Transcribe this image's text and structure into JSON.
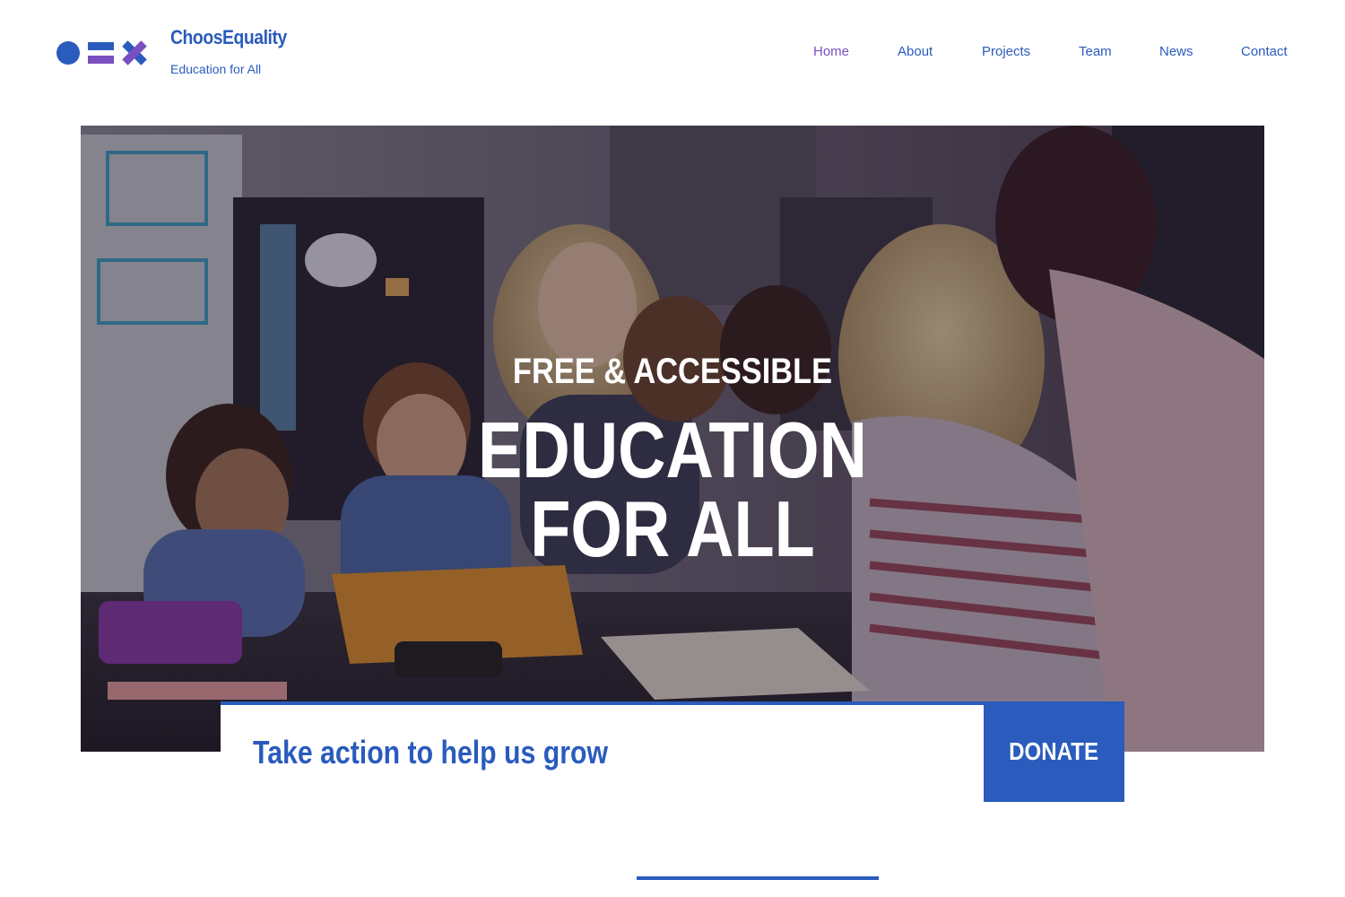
{
  "header": {
    "brand_name": "ChoosEquality",
    "tagline": "Education for All",
    "logo_icon": "circle-equals-cross-logo"
  },
  "nav": {
    "items": [
      {
        "label": "Home",
        "active": true
      },
      {
        "label": "About",
        "active": false
      },
      {
        "label": "Projects",
        "active": false
      },
      {
        "label": "Team",
        "active": false
      },
      {
        "label": "News",
        "active": false
      },
      {
        "label": "Contact",
        "active": false
      }
    ]
  },
  "hero": {
    "kicker": "FREE & ACCESSIBLE",
    "title": "EDUCATION FOR ALL",
    "image_alt": "Teacher with children in classroom"
  },
  "cta": {
    "text": "Take action to help us grow",
    "donate_label": "DONATE"
  },
  "colors": {
    "brand_blue": "#2a5bbd",
    "brand_purple": "#7a4fc0",
    "white": "#ffffff"
  }
}
